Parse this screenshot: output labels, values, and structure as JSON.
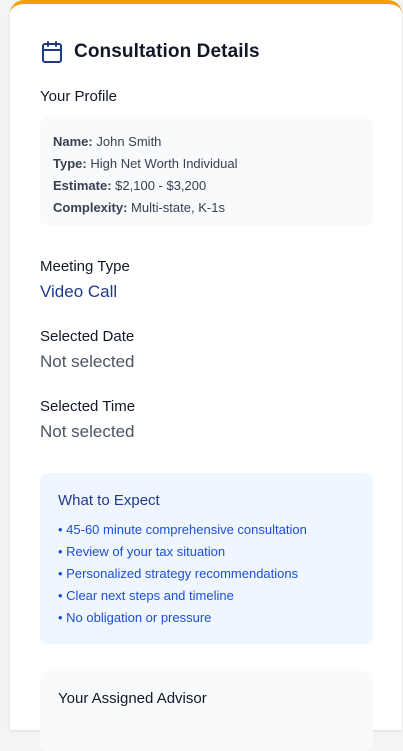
{
  "header": {
    "icon": "calendar-icon",
    "title": "Consultation Details",
    "accent_color": "#f59e0b"
  },
  "profile": {
    "label": "Your Profile",
    "fields": [
      {
        "key": "Name:",
        "value": "John Smith"
      },
      {
        "key": "Type:",
        "value": "High Net Worth Individual"
      },
      {
        "key": "Estimate:",
        "value": "$2,100 - $3,200"
      },
      {
        "key": "Complexity:",
        "value": "Multi-state, K-1s"
      }
    ]
  },
  "meeting": {
    "label": "Meeting Type",
    "value": "Video Call"
  },
  "date": {
    "label": "Selected Date",
    "value": "Not selected"
  },
  "time": {
    "label": "Selected Time",
    "value": "Not selected"
  },
  "expect": {
    "title": "What to Expect",
    "items": [
      "• 45-60 minute comprehensive consultation",
      "• Review of your tax situation",
      "• Personalized strategy recommendations",
      "• Clear next steps and timeline",
      "• No obligation or pressure"
    ]
  },
  "advisor": {
    "title": "Your Assigned Advisor"
  }
}
